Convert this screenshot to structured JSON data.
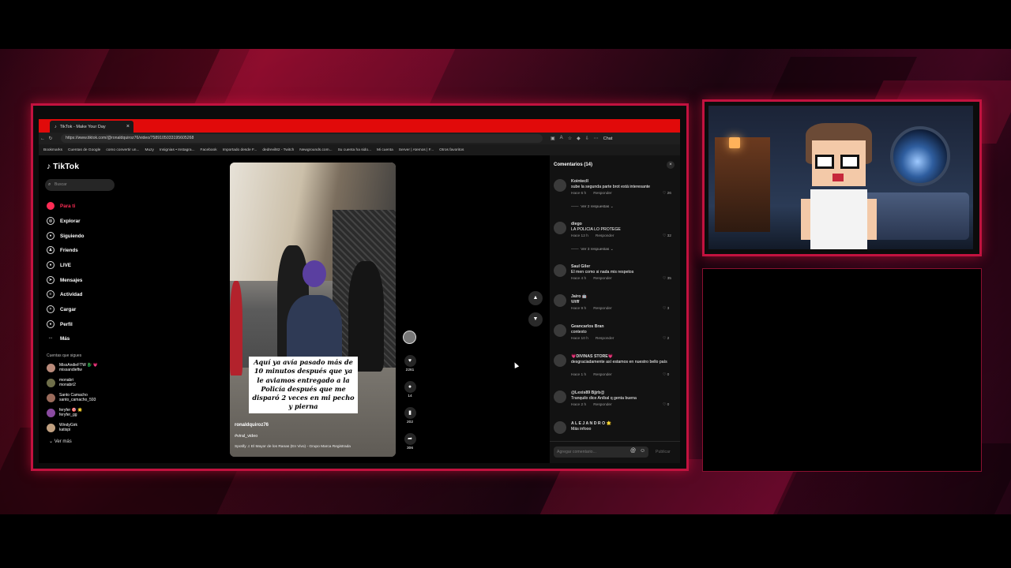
{
  "browser": {
    "tab_title": "TikTok - Make Your Day",
    "url": "https://www.tiktok.com/@ronaldquiroz76/video/7589105033195605268",
    "chat_label": "Chat",
    "bookmarks": [
      "Bookmarks",
      "Cuentas de Google",
      "como convertir un...",
      "Muzy",
      "Insignias • Instagra...",
      "Facebook",
      "Importado desde F...",
      "dedrevil82 - Twitch",
      "Newgrounds.com...",
      "Su cuenta ha sido...",
      "Mi cuenta",
      "Server | Atemos | F...",
      "Otros favoritos"
    ]
  },
  "tiktok": {
    "logo": "TikTok",
    "search_placeholder": "Buscar",
    "nav": [
      {
        "label": "Para ti",
        "icon": "home-icon",
        "active": true
      },
      {
        "label": "Explorar",
        "icon": "compass-icon"
      },
      {
        "label": "Siguiendo",
        "icon": "following-icon"
      },
      {
        "label": "Friends",
        "icon": "friends-icon"
      },
      {
        "label": "LIVE",
        "icon": "live-icon"
      },
      {
        "label": "Mensajes",
        "icon": "message-icon"
      },
      {
        "label": "Actividad",
        "icon": "activity-icon"
      },
      {
        "label": "Cargar",
        "icon": "upload-icon"
      },
      {
        "label": "Perfil",
        "icon": "profile-icon"
      },
      {
        "label": "Más",
        "icon": "more-icon"
      }
    ],
    "following_title": "Cuentas que sigues",
    "following": [
      {
        "name": "MissAndieFTW 🐉 💗",
        "handle": "missandieftw"
      },
      {
        "name": "monabri",
        "handle": "monabri2"
      },
      {
        "name": "Santo Camacho",
        "handle": "santo_camacho_593"
      },
      {
        "name": "feryfer 🎯 🌟",
        "handle": "feryfer_gg"
      },
      {
        "name": "WindyGirk",
        "handle": "katispi"
      }
    ],
    "see_more": "Ver más"
  },
  "video": {
    "caption": "Aquí ya avía pasado más de 10 minutos después que ya le aviamos entregado a la Policía después que me disparó 2 veces en mi pecho y pierna",
    "username": "ronaldquiroz76",
    "hashtag": "#viral_video",
    "music": "Spotify  ♫  El Mayor de los Ranas (En Vivo) - Grupo Marca Registrada",
    "likes": "2261",
    "comments": "14",
    "saves": "202",
    "shares": "306"
  },
  "comments_panel": {
    "title": "Comentarios (14)",
    "input_placeholder": "Agregar comentario...",
    "post_label": "Publicar",
    "reply_label": "Responder",
    "items": [
      {
        "user": "KointecII",
        "text": "sube la segunda parte brot está interesante",
        "time": "Hace 6 h",
        "likes": "26",
        "replies": "Ver 2 respuestas"
      },
      {
        "user": "diego",
        "text": "LA POLICIA LO PROTEGE",
        "time": "Hace 12 h",
        "likes": "32",
        "replies": "Ver 3 respuestas"
      },
      {
        "user": "Saul Giler",
        "text": "El men como si nada mis respetos",
        "time": "Hace 4 h",
        "likes": "35"
      },
      {
        "user": "Jairo 🤖",
        "text": "Wtfff",
        "time": "Hace 9 h",
        "likes": "3"
      },
      {
        "user": "Geancarlos Bran",
        "text": "contexto",
        "time": "Hace 10 h",
        "likes": "2"
      },
      {
        "user": "💗DIVINAS STORE💗",
        "text": "desgraciadamente así estamos en nuestro bello país",
        "time": "Hace 1 h",
        "likes": "0"
      },
      {
        "user": "@Lexis89 Bjjrb@",
        "text": "Tranquilo dice Aníbal q genta buena",
        "time": "Hace 2 h",
        "likes": "0"
      },
      {
        "user": "A L E J A N D R O 🌟",
        "text": "Más infooo",
        "time": "",
        "likes": ""
      }
    ]
  }
}
